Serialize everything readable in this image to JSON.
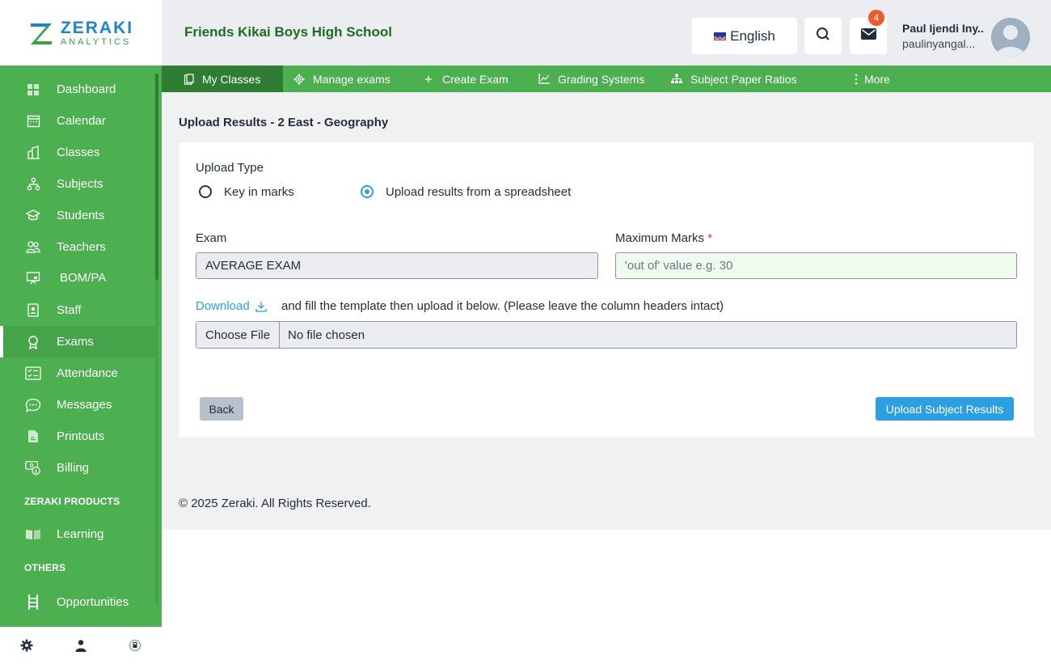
{
  "brand": {
    "name": "ZERAKI",
    "tagline": "ANALYTICS",
    "primary_color": "#4caf50",
    "accent_color": "#2c9fe0"
  },
  "sidebar": {
    "items": [
      {
        "label": "Dashboard",
        "icon": "dashboard-icon"
      },
      {
        "label": "Calendar",
        "icon": "calendar-icon"
      },
      {
        "label": "Classes",
        "icon": "building-icon"
      },
      {
        "label": "Subjects",
        "icon": "hierarchy-icon"
      },
      {
        "label": "Students",
        "icon": "graduation-cap-icon"
      },
      {
        "label": "Teachers",
        "icon": "users-icon"
      },
      {
        "label": "BOM/PA",
        "icon": "presentation-icon"
      },
      {
        "label": "Staff",
        "icon": "id-badge-icon"
      },
      {
        "label": "Exams",
        "icon": "award-icon",
        "active": true
      },
      {
        "label": "Attendance",
        "icon": "checklist-icon"
      },
      {
        "label": "Messages",
        "icon": "chat-icon"
      },
      {
        "label": "Printouts",
        "icon": "document-icon"
      },
      {
        "label": "Billing",
        "icon": "billing-icon"
      }
    ],
    "sections": {
      "products_title": "ZERAKI PRODUCTS",
      "products": [
        {
          "label": "Learning",
          "icon": "book-icon"
        }
      ],
      "others_title": "OTHERS",
      "others": [
        {
          "label": "Opportunities",
          "icon": "ladder-icon"
        }
      ]
    },
    "bottom_icons": [
      "settings-icon",
      "user-icon",
      "power-icon"
    ]
  },
  "header": {
    "school_name": "Friends Kikai Boys High School",
    "language": "English",
    "notification_count": "4",
    "user_name": "Paul Ijendi Iny...",
    "user_email": "paulinyangal..."
  },
  "tabs": [
    {
      "label": "My Classes",
      "icon": "clipboard-icon",
      "active": true
    },
    {
      "label": "Manage exams",
      "icon": "gear-icon"
    },
    {
      "label": "Create Exam",
      "icon": "plus-icon"
    },
    {
      "label": "Grading Systems",
      "icon": "chart-line-icon"
    },
    {
      "label": "Subject Paper Ratios",
      "icon": "sitemap-icon"
    },
    {
      "label": "More",
      "icon": "more-vertical-icon"
    }
  ],
  "page": {
    "title": "Upload Results - 2 East - Geography",
    "upload_type_label": "Upload Type",
    "radio_key_in": "Key in marks",
    "radio_spreadsheet": "Upload results from a spreadsheet",
    "selected_upload_type": "spreadsheet",
    "exam_label": "Exam",
    "exam_value": "AVERAGE EXAM",
    "max_marks_label": "Maximum Marks",
    "max_marks_required": "*",
    "max_marks_placeholder": "'out of' value e.g. 30",
    "download_link": "Download",
    "download_note": "and fill the template then upload it below. (Please leave the column headers intact)",
    "choose_file": "Choose File",
    "no_file": "No file chosen",
    "back_button": "Back",
    "upload_button": "Upload Subject Results"
  },
  "footer": {
    "copyright": "© 2025 Zeraki. All Rights Reserved."
  }
}
